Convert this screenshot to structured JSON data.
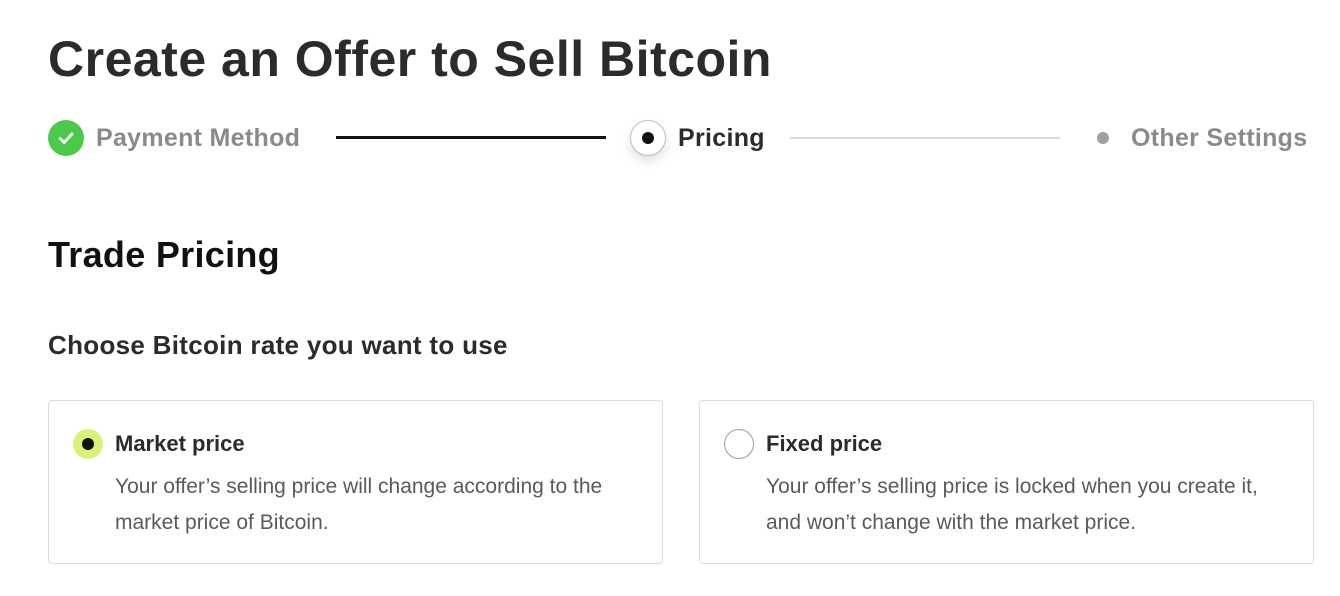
{
  "page_title": "Create an Offer to Sell Bitcoin",
  "stepper": {
    "steps": [
      {
        "label": "Payment Method",
        "status": "completed",
        "icon": "check-icon"
      },
      {
        "label": "Pricing",
        "status": "active",
        "icon": "active-step-dot-icon"
      },
      {
        "label": "Other Settings",
        "status": "pending",
        "icon": "pending-step-dot-icon"
      }
    ]
  },
  "section": {
    "title": "Trade Pricing",
    "question": "Choose Bitcoin rate you want to use"
  },
  "options": [
    {
      "title": "Market price",
      "description": "Your offer’s selling price will change according to the market price of Bitcoin.",
      "selected": true
    },
    {
      "title": "Fixed price",
      "description": "Your offer’s selling price is locked when you create it, and won’t change with the market price.",
      "selected": false
    }
  ],
  "colors": {
    "completed_green": "#4cc94a",
    "selected_radio_bg": "#d9f27a",
    "text_primary": "#2b2b2b",
    "text_muted": "#8a8a8a",
    "border": "#dcdcdc"
  }
}
